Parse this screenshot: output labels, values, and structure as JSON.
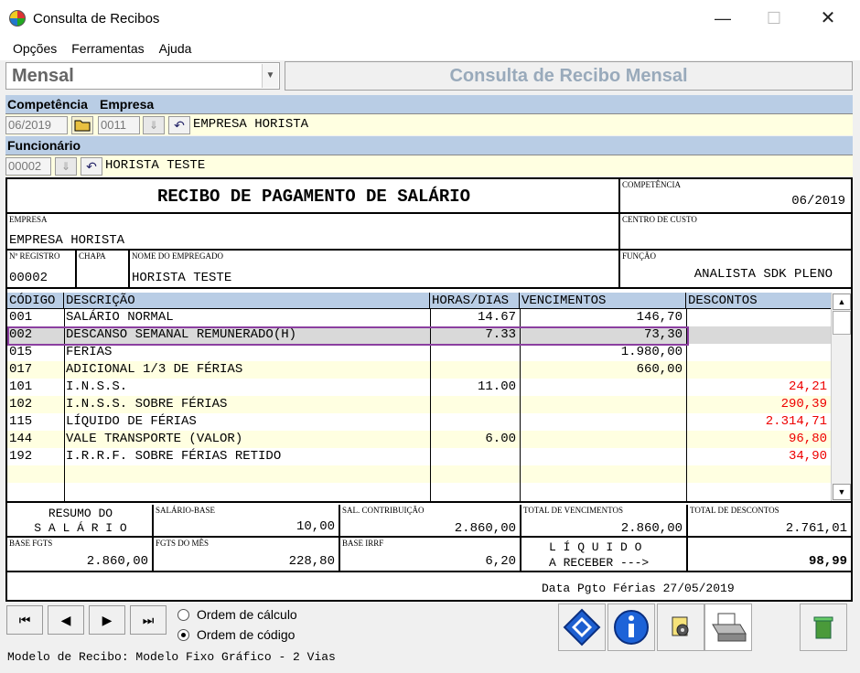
{
  "window": {
    "title": "Consulta de Recibos",
    "minimize": "—",
    "maximize": "☐",
    "close": "✕"
  },
  "menu": [
    "Opções",
    "Ferramentas",
    "Ajuda"
  ],
  "mode_select": {
    "value": "Mensal",
    "arrow": "▼"
  },
  "banner": "Consulta de Recibo Mensal",
  "competencia": {
    "label": "Competência",
    "value": "06/2019"
  },
  "empresa": {
    "label": "Empresa",
    "code": "0011",
    "name": "EMPRESA HORISTA"
  },
  "funcionario": {
    "label": "Funcionário",
    "code": "00002",
    "name": "HORISTA TESTE"
  },
  "field_icons": {
    "folder": "folder-icon",
    "download": "⇓",
    "undo": "↶"
  },
  "receipt": {
    "title": "RECIBO DE PAGAMENTO DE SALÁRIO",
    "competencia_label": "COMPETÊNCIA",
    "competencia_value": "06/2019",
    "empresa_label": "EMPRESA",
    "empresa_value": "EMPRESA HORISTA",
    "centro_label": "CENTRO DE CUSTO",
    "centro_value": "",
    "registro_label": "Nº REGISTRO",
    "registro_value": "00002",
    "chapa_label": "CHAPA",
    "chapa_value": "",
    "nome_label": "NOME DO EMPREGADO",
    "nome_value": "HORISTA TESTE",
    "funcao_label": "FUNÇÃO",
    "funcao_value": "ANALISTA SDK PLENO"
  },
  "items_header": {
    "codigo": "CÓDIGO",
    "descricao": "DESCRIÇÃO",
    "horas": "HORAS/DIAS",
    "vencimentos": "VENCIMENTOS",
    "descontos": "DESCONTOS"
  },
  "items": [
    {
      "codigo": "001",
      "descricao": "SALÁRIO NORMAL",
      "horas": "14.67",
      "vencimentos": "146,70",
      "descontos": ""
    },
    {
      "codigo": "002",
      "descricao": "DESCANSO SEMANAL REMUNERADO(H)",
      "horas": "7.33",
      "vencimentos": "73,30",
      "descontos": ""
    },
    {
      "codigo": "015",
      "descricao": "FÉRIAS",
      "horas": "",
      "vencimentos": "1.980,00",
      "descontos": ""
    },
    {
      "codigo": "017",
      "descricao": "ADICIONAL 1/3 DE FÉRIAS",
      "horas": "",
      "vencimentos": "660,00",
      "descontos": ""
    },
    {
      "codigo": "101",
      "descricao": "I.N.S.S.",
      "horas": "11.00",
      "vencimentos": "",
      "descontos": "24,21"
    },
    {
      "codigo": "102",
      "descricao": "I.N.S.S. SOBRE FÉRIAS",
      "horas": "",
      "vencimentos": "",
      "descontos": "290,39"
    },
    {
      "codigo": "115",
      "descricao": "LÍQUIDO DE FÉRIAS",
      "horas": "",
      "vencimentos": "",
      "descontos": "2.314,71"
    },
    {
      "codigo": "144",
      "descricao": "VALE TRANSPORTE (VALOR)",
      "horas": "6.00",
      "vencimentos": "",
      "descontos": "96,80"
    },
    {
      "codigo": "192",
      "descricao": "I.R.R.F. SOBRE FÉRIAS RETIDO",
      "horas": "",
      "vencimentos": "",
      "descontos": "34,90"
    }
  ],
  "scroll": {
    "up": "▲",
    "down": "▼"
  },
  "resumo": {
    "label_line1": "RESUMO DO",
    "label_line2": "S A L Á R I O",
    "salario_base_label": "SALÁRIO-BASE",
    "salario_base_value": "10,00",
    "sal_contrib_label": "SAL. CONTRIBUIÇÃO",
    "sal_contrib_value": "2.860,00",
    "total_venc_label": "TOTAL DE VENCIMENTOS",
    "total_venc_value": "2.860,00",
    "total_desc_label": "TOTAL DE DESCONTOS",
    "total_desc_value": "2.761,01",
    "base_fgts_label": "BASE FGTS",
    "base_fgts_value": "2.860,00",
    "fgts_mes_label": "FGTS DO MÊS",
    "fgts_mes_value": "228,80",
    "base_irrf_label": "BASE IRRF",
    "base_irrf_value": "6,20",
    "liquido_line1": "L Í Q U I D O",
    "liquido_line2": "A RECEBER --->",
    "liquido_value": "98,99",
    "data_pgto": "Data Pgto Férias 27/05/2019"
  },
  "nav": {
    "first": "⏮",
    "prev": "◀",
    "next": "▶",
    "last": "⏭"
  },
  "order": {
    "calc": "Ordem de cálculo",
    "code": "Ordem de código",
    "selected": "code"
  },
  "modelo": "Modelo de Recibo: Modelo Fixo Gráfico - 2 Vias",
  "colors": {
    "label_bar": "#b9cde5",
    "field_bg": "#ffffe1",
    "negative": "#ee0000",
    "highlight": "#8b3fa0"
  }
}
